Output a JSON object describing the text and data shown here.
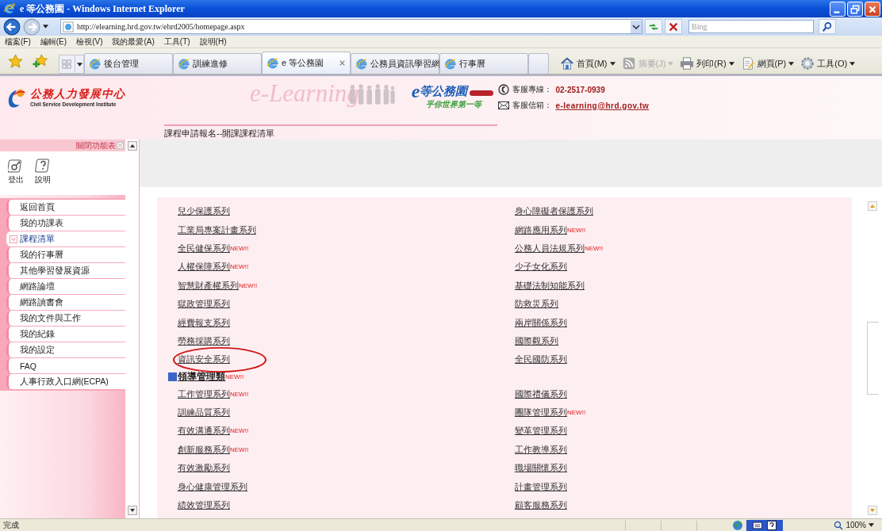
{
  "window": {
    "title": "e 等公務園 - Windows Internet Explorer"
  },
  "address_bar": {
    "url": "http://elearning.hrd.gov.tw/ehrd2005/homepage.aspx"
  },
  "search": {
    "placeholder": "Bing"
  },
  "menu": [
    "檔案(F)",
    "編輯(E)",
    "檢視(V)",
    "我的最愛(A)",
    "工具(T)",
    "說明(H)"
  ],
  "tabs": [
    {
      "label": "後台管理",
      "selected": false
    },
    {
      "label": "訓練進修",
      "selected": false
    },
    {
      "label": "e 等公務園",
      "selected": true
    },
    {
      "label": "公務員資訊學習網",
      "selected": false
    },
    {
      "label": "行事曆",
      "selected": false
    }
  ],
  "commands": [
    {
      "label": "首頁(M)",
      "disabled": false
    },
    {
      "label": "摘要(J)",
      "disabled": true
    },
    {
      "label": "列印(R)",
      "disabled": false
    },
    {
      "label": "網頁(P)",
      "disabled": false
    },
    {
      "label": "工具(O)",
      "disabled": false
    }
  ],
  "site": {
    "org_name": "公務人力發展中心",
    "org_name_en": "Civil Service Development Institute",
    "banner": "e-Learning",
    "portal_letter": "e",
    "portal_name": "等公務園",
    "slogan": "乎你世界第一等",
    "hotline_label": "客服專線：",
    "hotline": "02-2517-0939",
    "mail_label": "客服信箱：",
    "mail": "e-learning@hrd.gov.tw",
    "breadcrumb": "課程申請報名--開課課程清單"
  },
  "sidebar": {
    "close_label": "關閉功能表",
    "tools": [
      {
        "label": "登出"
      },
      {
        "label": "說明"
      }
    ],
    "items": [
      {
        "label": "返回首頁",
        "selected": false
      },
      {
        "label": "我的功課表",
        "selected": false
      },
      {
        "label": "課程清單",
        "selected": true
      },
      {
        "label": "我的行事曆",
        "selected": false
      },
      {
        "label": "其他學習發展資源",
        "selected": false
      },
      {
        "label": "網路論壇",
        "selected": false
      },
      {
        "label": "網路讀書會",
        "selected": false
      },
      {
        "label": "我的文件與工作",
        "selected": false
      },
      {
        "label": "我的紀錄",
        "selected": false
      },
      {
        "label": "我的設定",
        "selected": false
      },
      {
        "label": "FAQ",
        "selected": false
      },
      {
        "label": "人事行政入口網(ECPA)",
        "selected": false
      }
    ]
  },
  "course_rows": [
    {
      "kind": "pair",
      "left": {
        "label": "兒少保護系列",
        "circled": false
      },
      "right": {
        "label": "身心障礙者保護系列",
        "circled": false
      }
    },
    {
      "kind": "pair",
      "left": {
        "label": "工業局專案計畫系列",
        "circled": false
      },
      "right": {
        "label": "網路應用系列",
        "badge": "NEW!!",
        "circled": false
      }
    },
    {
      "kind": "pair",
      "left": {
        "label": "全民健保系列",
        "badge": "NEW!!",
        "circled": false
      },
      "right": {
        "label": "公務人員法規系列",
        "badge": "NEW!!",
        "circled": false
      }
    },
    {
      "kind": "pair",
      "left": {
        "label": "人權保障系列",
        "badge": "NEW!!",
        "circled": false
      },
      "right": {
        "label": "少子女化系列",
        "circled": false
      }
    },
    {
      "kind": "pair",
      "left": {
        "label": "智慧財產權系列",
        "badge": "NEW!!",
        "circled": false
      },
      "right": {
        "label": "基礎法制知能系列",
        "circled": false
      }
    },
    {
      "kind": "pair",
      "left": {
        "label": "獄政管理系列",
        "circled": false
      },
      "right": {
        "label": "防救災系列",
        "circled": false
      }
    },
    {
      "kind": "pair",
      "left": {
        "label": "經費報支系列",
        "circled": false
      },
      "right": {
        "label": "兩岸關係系列",
        "circled": false
      }
    },
    {
      "kind": "pair",
      "left": {
        "label": "勞務採購系列",
        "circled": false
      },
      "right": {
        "label": "國際觀系列",
        "circled": false
      }
    },
    {
      "kind": "pair",
      "left": {
        "label": "資訊安全系列",
        "circled": true
      },
      "right": {
        "label": "全民國防系列",
        "circled": false
      }
    },
    {
      "kind": "category",
      "label": "領導管理類",
      "badge": "NEW!!"
    },
    {
      "kind": "pair",
      "left": {
        "label": "工作管理系列",
        "badge": "NEW!!",
        "circled": false
      },
      "right": {
        "label": "國際禮儀系列",
        "circled": false
      }
    },
    {
      "kind": "pair",
      "left": {
        "label": "訓練品質系列",
        "circled": false
      },
      "right": {
        "label": "團隊管理系列",
        "badge": "NEW!!",
        "circled": false
      }
    },
    {
      "kind": "pair",
      "left": {
        "label": "有效溝通系列",
        "badge": "NEW!!",
        "circled": false
      },
      "right": {
        "label": "變革管理系列",
        "circled": false
      }
    },
    {
      "kind": "pair",
      "left": {
        "label": "創新服務系列",
        "badge": "NEW!!",
        "circled": false
      },
      "right": {
        "label": "工作教導系列",
        "circled": false
      }
    },
    {
      "kind": "pair",
      "left": {
        "label": "有效激勵系列",
        "circled": false
      },
      "right": {
        "label": "職場關懷系列",
        "circled": false
      }
    },
    {
      "kind": "pair",
      "left": {
        "label": "身心健康管理系列",
        "circled": false
      },
      "right": {
        "label": "計畫管理系列",
        "circled": false
      }
    },
    {
      "kind": "pair",
      "left": {
        "label": "績效管理系列",
        "circled": false
      },
      "right": {
        "label": "顧客服務系列",
        "circled": false
      }
    }
  ],
  "status_bar": {
    "text": "完成",
    "zoom": "100%"
  }
}
